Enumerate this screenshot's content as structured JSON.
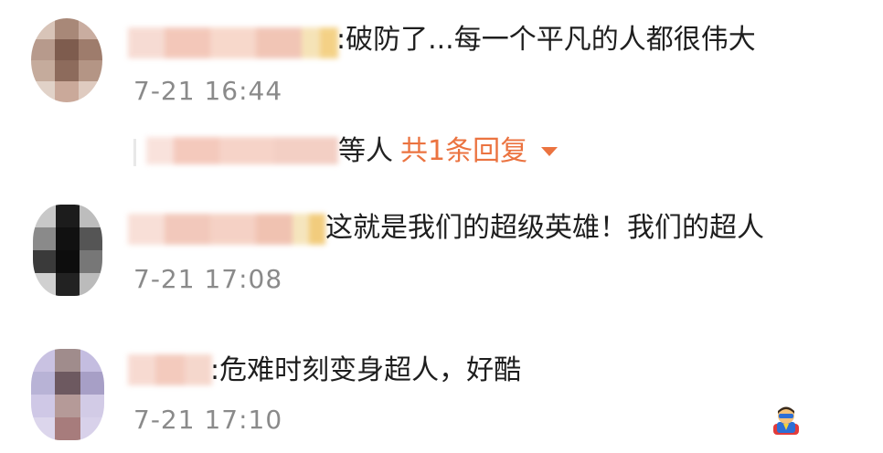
{
  "comments": [
    {
      "text": ":破防了...每一个平凡的人都很伟大",
      "time": "7-21 16:44"
    },
    {
      "text": "这就是我们的超级英雄！我们的超人",
      "time": "7-21 17:08",
      "emoji": "superhero-emoji"
    },
    {
      "text": ":危难时刻变身超人，好酷",
      "time": "7-21 17:10"
    }
  ],
  "reply": {
    "who_suffix": "等人",
    "count_label": "共1条回复",
    "caret_icon": "chevron-down-icon"
  },
  "colors": {
    "accent": "#eb7340",
    "time": "#8a8a8a",
    "text": "#1e1e1e"
  }
}
